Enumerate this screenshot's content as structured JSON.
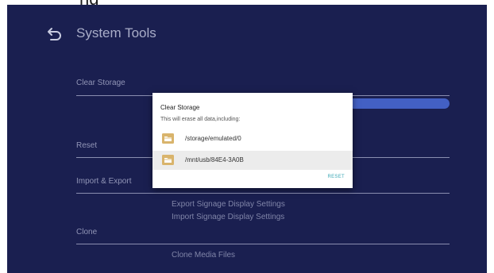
{
  "header": {
    "title": "System Tools"
  },
  "menu": {
    "clear_storage": "Clear Storage",
    "reset": "Reset",
    "import_export": "Import & Export",
    "export_settings": "Export Signage Display Settings",
    "import_settings": "Import Signage Display Settings",
    "clone": "Clone",
    "clone_media": "Clone Media Files"
  },
  "dialog": {
    "title": "Clear Storage",
    "message": "This will erase all data,including:",
    "items": [
      {
        "path": "/storage/emulated/0",
        "icon": "folder-icon"
      },
      {
        "path": "/mnt/usb/84E4-3A0B",
        "icon": "folder-icon"
      }
    ],
    "reset_label": "RESET"
  },
  "colors": {
    "background": "#1a1f50",
    "accent": "#4360c4",
    "dialog_button": "#3aa7b5",
    "folder": "#d9b46c"
  }
}
